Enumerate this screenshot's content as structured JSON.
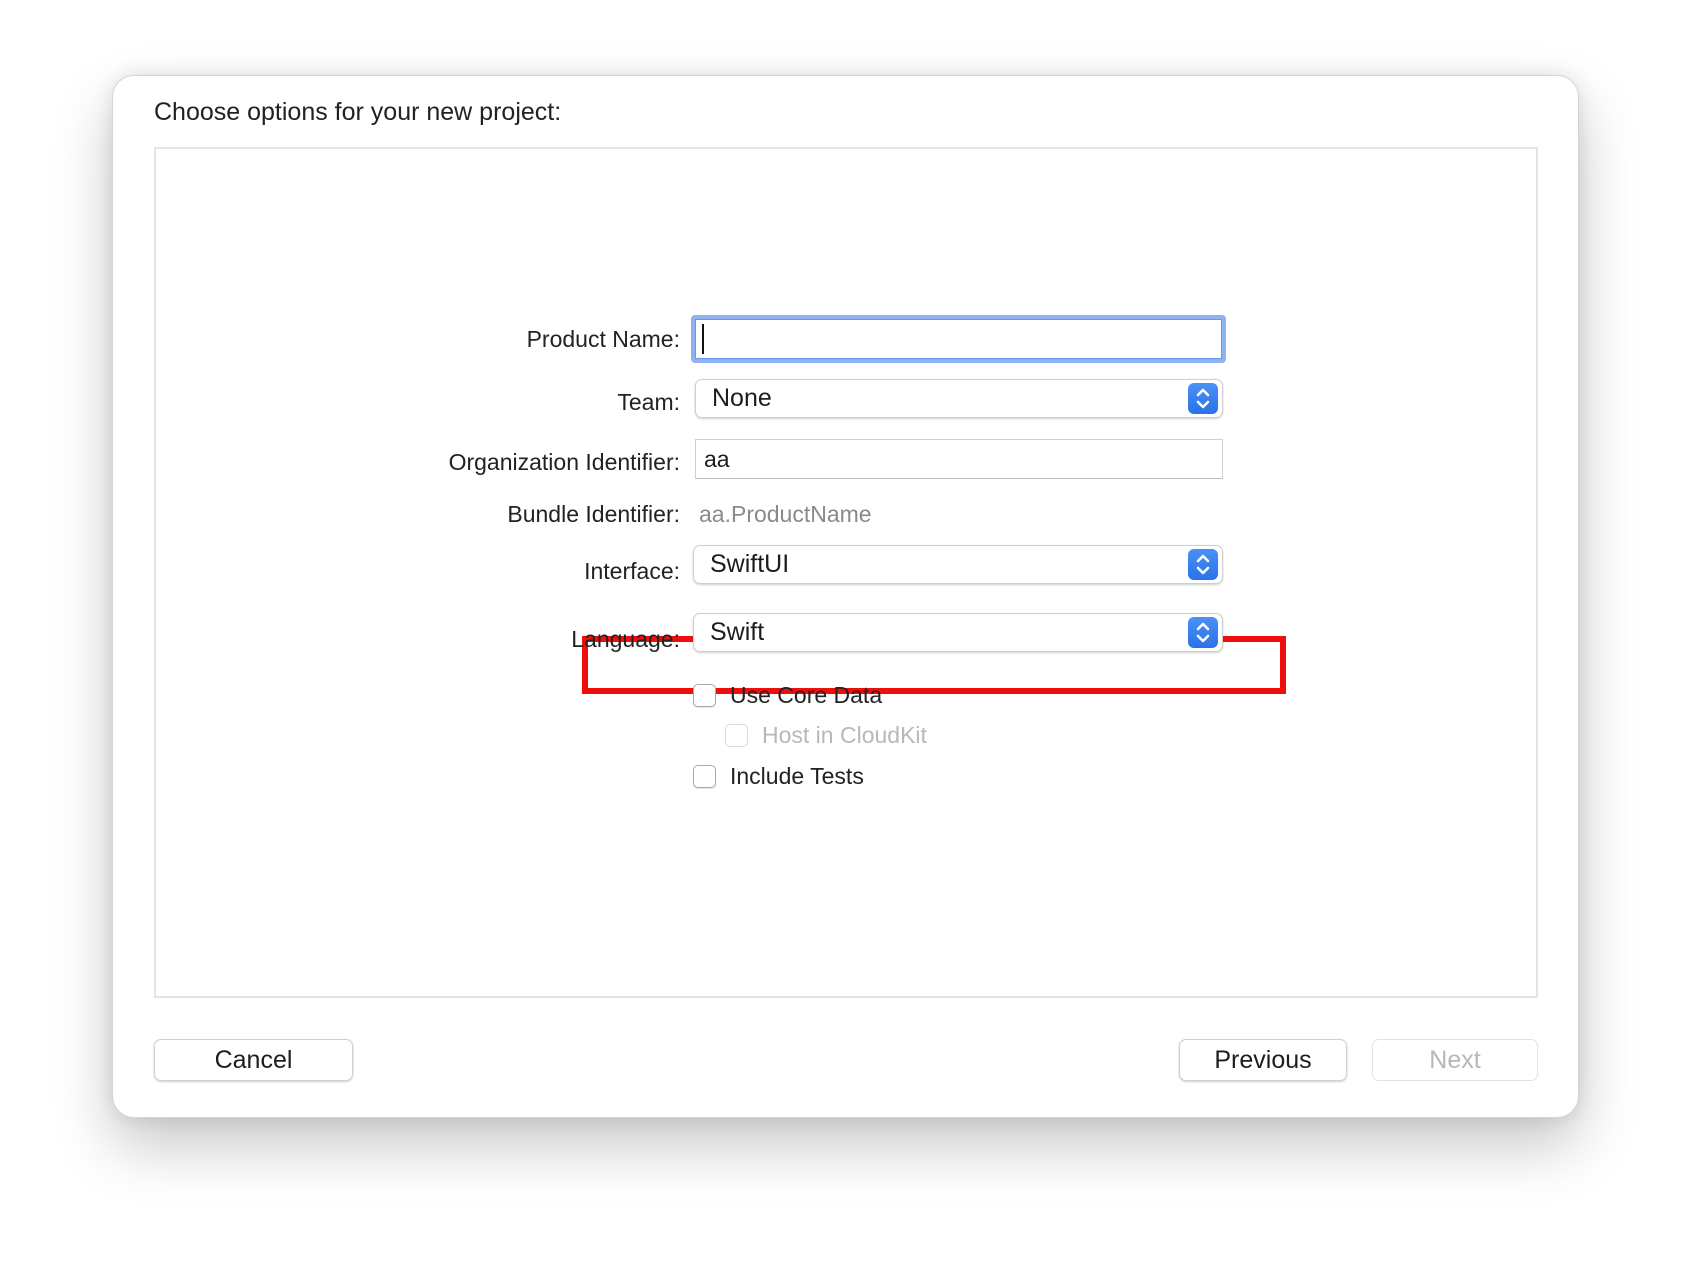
{
  "dialog": {
    "title": "Choose options for your new project:"
  },
  "form": {
    "product_name": {
      "label": "Product Name:",
      "value": ""
    },
    "team": {
      "label": "Team:",
      "value": "None"
    },
    "organization_identifier": {
      "label": "Organization Identifier:",
      "value": "aa"
    },
    "bundle_identifier": {
      "label": "Bundle Identifier:",
      "value": "aa.ProductName"
    },
    "interface": {
      "label": "Interface:",
      "value": "SwiftUI"
    },
    "language": {
      "label": "Language:",
      "value": "Swift"
    },
    "checkboxes": [
      {
        "label": "Use Core Data",
        "checked": false,
        "enabled": true
      },
      {
        "label": "Host in CloudKit",
        "checked": false,
        "enabled": false
      },
      {
        "label": "Include Tests",
        "checked": false,
        "enabled": true
      }
    ]
  },
  "buttons": {
    "cancel": "Cancel",
    "previous": "Previous",
    "next": "Next"
  },
  "colors": {
    "highlight": "#f20d0d",
    "accent": "#2a72e8",
    "focus_ring": "#8fb3f0"
  },
  "icons": {
    "popup_arrows": "chevron-up-down-icon"
  }
}
